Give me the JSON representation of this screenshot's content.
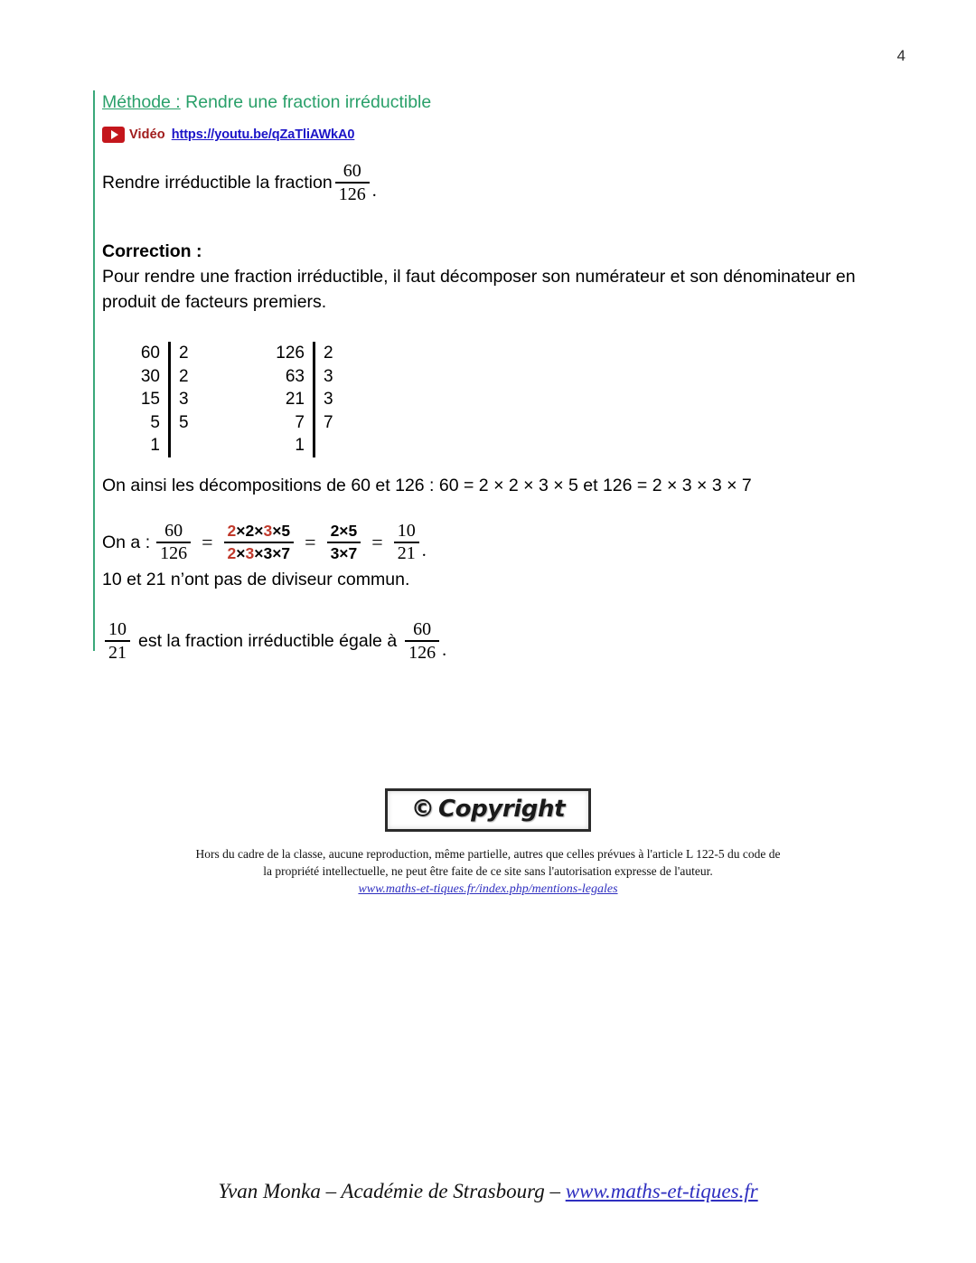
{
  "page": {
    "number": "4"
  },
  "method": {
    "label": "Méthode :",
    "title": " Rendre une fraction irréductible",
    "video_icon": "youtube-play-icon",
    "video_word": "Vidéo",
    "video_url": "https://youtu.be/qZaTliAWkA0",
    "accent_color": "#2aa06a",
    "link_color": "#1b14c8",
    "video_word_color": "#a01b1b"
  },
  "statement": {
    "prefix": "Rendre irréductible la fraction ",
    "fraction": {
      "num": "60",
      "den": "126"
    },
    "suffix": "."
  },
  "correction": {
    "title": "Correction :",
    "body": "Pour rendre une fraction irréductible, il faut décomposer son numérateur et son dénominateur en produit de facteurs premiers."
  },
  "division_tables": [
    {
      "name": "decomposition-60",
      "dividends": [
        "60",
        "30",
        "15",
        "5",
        "1"
      ],
      "divisors": [
        "2",
        "2",
        "3",
        "5",
        ""
      ]
    },
    {
      "name": "decomposition-126",
      "dividends": [
        "126",
        "63",
        "21",
        "7",
        "1"
      ],
      "divisors": [
        "2",
        "3",
        "3",
        "7",
        ""
      ]
    }
  ],
  "decomposition_line": "On ainsi les décompositions de 60 et 126 :  60 = 2 × 2 × 3 × 5 et 126 = 2 × 3 × 3 × 7",
  "equation": {
    "lead": "On a :",
    "f1": {
      "num": "60",
      "den": "126"
    },
    "eq1": "=",
    "f2": {
      "num_parts": [
        {
          "t": "2",
          "red": true
        },
        {
          "t": "×2×",
          "red": false
        },
        {
          "t": "3",
          "red": true
        },
        {
          "t": "×5",
          "red": false
        }
      ],
      "den_parts": [
        {
          "t": "2",
          "red": true
        },
        {
          "t": "×",
          "red": false
        },
        {
          "t": "3",
          "red": true
        },
        {
          "t": "×3×7",
          "red": false
        }
      ]
    },
    "eq2": "=",
    "f3": {
      "num": "2×5",
      "den": "3×7"
    },
    "eq3": "=",
    "f4": {
      "num": "10",
      "den": "21"
    },
    "period": ".",
    "red_color": "#c0392b"
  },
  "no_common_divisor": "10 et 21 n’ont pas de diviseur commun.",
  "final": {
    "fraction_left": {
      "num": "10",
      "den": "21"
    },
    "text": " est la fraction irréductible égale à ",
    "fraction_right": {
      "num": "60",
      "den": "126"
    },
    "suffix": "."
  },
  "copyright": {
    "badge_symbol": "©",
    "badge_text": "Copyright",
    "legal_line1": "Hors du cadre de la classe, aucune reproduction, même partielle, autres que celles prévues à l'article L 122-5 du code de",
    "legal_line2": "la propriété intellectuelle, ne peut être faite de ce site sans l'autorisation expresse de l'auteur.",
    "legal_link": "www.maths-et-tiques.fr/index.php/mentions-legales"
  },
  "footer": {
    "text": "Yvan Monka – Académie de Strasbourg – ",
    "link": "www.maths-et-tiques.fr"
  }
}
